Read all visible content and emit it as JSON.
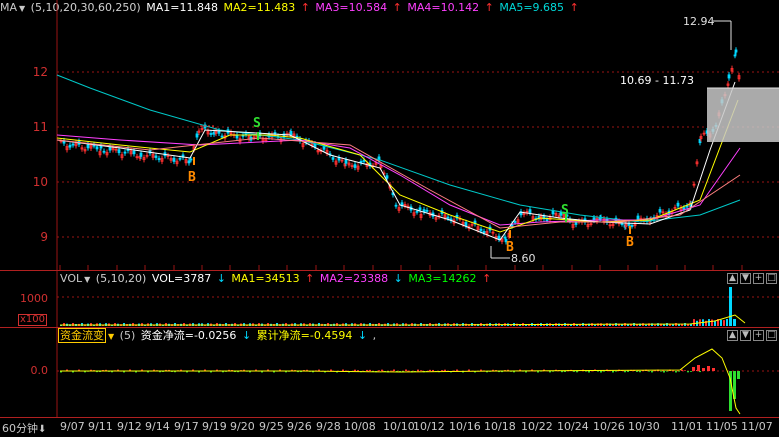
{
  "main_header": {
    "indicator": "MA",
    "params": "(5,10,20,30,60,250)",
    "ma1": "MA1=11.848",
    "ma2": "MA2=11.483",
    "ma3": "MA3=10.584",
    "ma4": "MA4=10.142",
    "ma5": "MA5=9.685",
    "arrow_up": "↑",
    "arrow_down": "↓"
  },
  "vol_header": {
    "indicator": "VOL",
    "params": "(5,10,20)",
    "vol": "VOL=3787",
    "ma1": "MA1=34513",
    "ma2": "MA2=23388",
    "ma3": "MA3=14262"
  },
  "flow_header": {
    "indicator": "资金流变",
    "params": "(5)",
    "net": "资金净流=-0.0256",
    "cum": "累计净流=-0.4594",
    "tail": ","
  },
  "window_buttons": [
    "▲",
    "▼",
    "+",
    "□"
  ],
  "price_axis": [
    "12",
    "11",
    "10",
    "9"
  ],
  "vol_axis": [
    "1000",
    "x100"
  ],
  "flow_axis": [
    "0.0"
  ],
  "annotations": {
    "high_label": "12.94",
    "low_label": "8.60",
    "range_label": "10.69 - 11.73"
  },
  "signals": [
    {
      "label": "B",
      "color": "#ff8a00"
    },
    {
      "label": "S",
      "color": "#30e030"
    },
    {
      "label": "B",
      "color": "#ff8a00"
    },
    {
      "label": "S",
      "color": "#30e030"
    },
    {
      "label": "B",
      "color": "#ff8a00"
    }
  ],
  "period_selector": "60分钟",
  "x_dates": [
    "9/07",
    "9/11",
    "9/12",
    "9/14",
    "9/17",
    "9/19",
    "9/20",
    "9/25",
    "9/26",
    "9/28",
    "10/08",
    "10/10",
    "10/12",
    "10/16",
    "10/18",
    "10/22",
    "10/24",
    "10/26",
    "10/30",
    "11/01",
    "11/05",
    "11/07"
  ],
  "colors": {
    "up": "#ff3030",
    "down": "#00d8ff",
    "grid": "#9a1515",
    "ma1": "#ffffff",
    "ma2": "#ffff00",
    "ma3": "#ff40ff",
    "ma4": "#30ff30",
    "ma5": "#00c8c8",
    "ma6": "#ff8080"
  }
}
